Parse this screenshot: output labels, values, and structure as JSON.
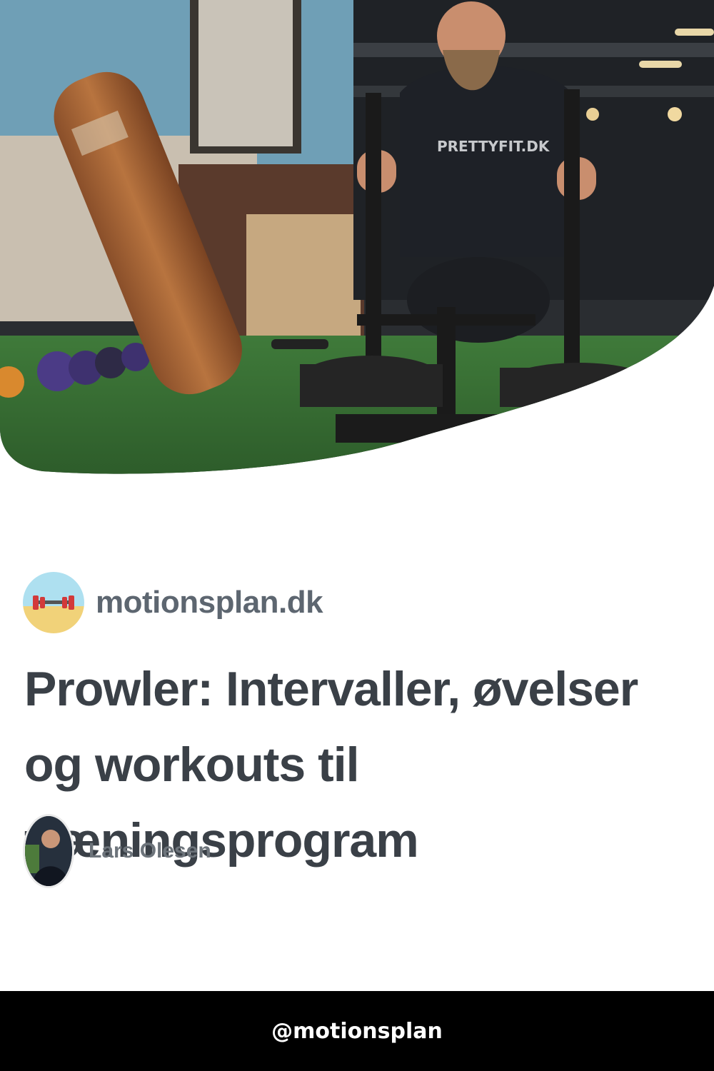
{
  "hero": {
    "image_subject": "man-pushing-prowler-sled-in-gym",
    "shirt_text": "PRETTYFIT.DK"
  },
  "site": {
    "name": "motionsplan.dk",
    "logo_icon": "barbell-icon"
  },
  "article": {
    "title": "Prowler: Intervaller, øvelser og workouts til træningsprogram"
  },
  "author": {
    "name": "Lars Olesen"
  },
  "footer": {
    "handle": "@motionsplan"
  },
  "colors": {
    "site_name": "#5d6670",
    "title": "#3a4047",
    "author": "#6d747b",
    "footer_bg": "#000000",
    "footer_text": "#ffffff"
  }
}
